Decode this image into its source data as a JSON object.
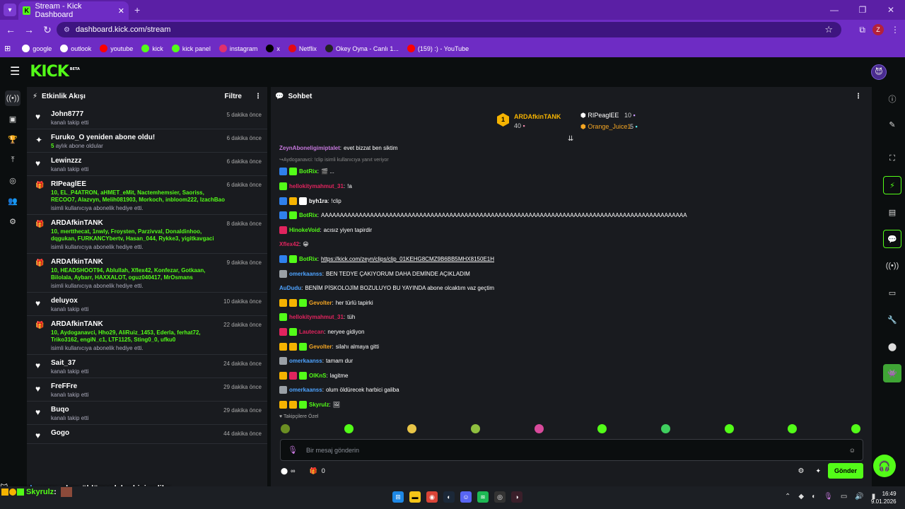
{
  "browser": {
    "tab_title": "Stream - Kick Dashboard",
    "tab_favicon": "K",
    "url": "dashboard.kick.com/stream",
    "profile_initial": "Z",
    "bookmarks": [
      {
        "label": "google",
        "icon": "globe-icon",
        "color": "#ffffff"
      },
      {
        "label": "outlook",
        "icon": "globe-icon",
        "color": "#ffffff"
      },
      {
        "label": "youtube",
        "icon": "youtube-icon",
        "color": "#ff0000"
      },
      {
        "label": "kick",
        "icon": "kick-icon",
        "color": "#53fc18"
      },
      {
        "label": "kick panel",
        "icon": "kick-icon",
        "color": "#53fc18"
      },
      {
        "label": "instagram",
        "icon": "instagram-icon",
        "color": "#e1306c"
      },
      {
        "label": "x",
        "icon": "x-icon",
        "color": "#000000"
      },
      {
        "label": "Netflix",
        "icon": "netflix-icon",
        "color": "#e50914"
      },
      {
        "label": "Okey Oyna - Canlı 1...",
        "icon": "okey-icon",
        "color": "#222222"
      },
      {
        "label": "(159) :) - YouTube",
        "icon": "youtube-icon",
        "color": "#ff0000"
      }
    ]
  },
  "app": {
    "logo": "KICK",
    "logo_badge": "BETA"
  },
  "activity": {
    "title": "Etkinlik Akışı",
    "filter_label": "Filtre",
    "events": [
      {
        "icon": "heart-icon",
        "name": "John8777",
        "time": "5 dakika önce",
        "sub": "kanalı takip etti",
        "extra": "",
        "extra_prefix": ""
      },
      {
        "icon": "sparkle-icon",
        "name": "Furuko_O yeniden abone oldu!",
        "time": "6 dakika önce",
        "sub": "aylık abone oldular",
        "extra": "",
        "extra_prefix": "5"
      },
      {
        "icon": "heart-icon",
        "name": "Lewinzzz",
        "time": "6 dakika önce",
        "sub": "kanalı takip etti",
        "extra": "",
        "extra_prefix": ""
      },
      {
        "icon": "gift-icon",
        "name": "RIPeaglEE",
        "time": "6 dakika önce",
        "sub": "isimli kullanıcıya abonelik hediye etti.",
        "extra": "10, EL_P4ATRON, aHMET_eMit, Nactemhemsier, Saoriss, RECOO7, Alazvyn, Melih081903, Morkoch, inbloom222, IzachBao",
        "extra_prefix": ""
      },
      {
        "icon": "gift-icon",
        "name": "ARDAfkinTANK",
        "time": "8 dakika önce",
        "sub": "isimli kullanıcıya abonelik hediye etti.",
        "extra": "10, mertthecat, 1nwly, Froysten, Parzivval, Donaldinhoo, dqgukan, FURKANCYbertv, Hasan_044, Rykke3, yigitkavgaci",
        "extra_prefix": ""
      },
      {
        "icon": "gift-icon",
        "name": "ARDAfkinTANK",
        "time": "9 dakika önce",
        "sub": "isimli kullanıcıya abonelik hediye etti.",
        "extra": "10, HEADSHOOT94, Ablullah, Xflex42, Konfezar, Gotkaan, Bilolala, Aybarr, HAXXALOT, oguz040417, MrOsmans",
        "extra_prefix": ""
      },
      {
        "icon": "heart-icon",
        "name": "deluyox",
        "time": "10 dakika önce",
        "sub": "kanalı takip etti",
        "extra": "",
        "extra_prefix": ""
      },
      {
        "icon": "gift-icon",
        "name": "ARDAfkinTANK",
        "time": "22 dakika önce",
        "sub": "isimli kullanıcıya abonelik hediye etti.",
        "extra": "10, Aydoganavci, Hho29, AliRuiz_1453, Ederla, ferhat72, Triko3162, engiN_c1, LTF1125, Sting0_0, ufku0",
        "extra_prefix": ""
      },
      {
        "icon": "heart-icon",
        "name": "Sait_37",
        "time": "24 dakika önce",
        "sub": "kanalı takip etti",
        "extra": "",
        "extra_prefix": ""
      },
      {
        "icon": "heart-icon",
        "name": "FreFFre",
        "time": "29 dakika önce",
        "sub": "kanalı takip etti",
        "extra": "",
        "extra_prefix": ""
      },
      {
        "icon": "heart-icon",
        "name": "Buqo",
        "time": "29 dakika önce",
        "sub": "kanalı takip etti",
        "extra": "",
        "extra_prefix": ""
      },
      {
        "icon": "heart-icon",
        "name": "Gogo",
        "time": "44 dakika önce",
        "sub": "",
        "extra": "",
        "extra_prefix": ""
      }
    ]
  },
  "chat": {
    "title": "Sohbet",
    "leaderboard": {
      "first": {
        "rank": "1",
        "name": "ARDAfkinTANK",
        "count": "40"
      },
      "second": {
        "name": "RIPeaglEE",
        "count": "10"
      },
      "third": {
        "name": "Orange_Juice1",
        "count": "5"
      }
    },
    "messages": [
      {
        "type": "msg",
        "badges": [],
        "user": "ZeynAboneligimiptalet",
        "color": "#c678dd",
        "text": "evet bizzat ben siktim"
      },
      {
        "type": "reply",
        "text": "Aydoganavci: !clip isimli kullanıcıya yanıt veriyor"
      },
      {
        "type": "msg",
        "badges": [
          "#2f80ed",
          "#53fc18"
        ],
        "user": "BotRix",
        "color": "#53fc18",
        "text": "🎬 ..."
      },
      {
        "type": "msg",
        "badges": [
          "#53fc18"
        ],
        "user": "hellokitymahmut_31",
        "color": "#e0245e",
        "text": "!a"
      },
      {
        "type": "msg",
        "badges": [
          "#2f80ed",
          "#f5b301",
          "#ffffff"
        ],
        "user": "byh1ra",
        "color": "#ffffff",
        "text": "!clip"
      },
      {
        "type": "msg",
        "badges": [
          "#2f80ed",
          "#53fc18"
        ],
        "user": "BotRix",
        "color": "#53fc18",
        "text": "AAAAAAAAAAAAAAAAAAAAAAAAAAAAAAAAAAAAAAAAAAAAAAAAAAAAAAAAAAAAAAAAAAAAAAAAAAAAAAAAAAAAAAAAAAAAAAAAA"
      },
      {
        "type": "msg",
        "badges": [
          "#e0245e"
        ],
        "user": "HinokeVoid",
        "color": "#53fc18",
        "text": "acısız yiyen tapirdir"
      },
      {
        "type": "msg",
        "badges": [],
        "user": "Xflex42",
        "color": "#e0245e",
        "text": "😀"
      },
      {
        "type": "msg",
        "badges": [
          "#2f80ed",
          "#53fc18"
        ],
        "user": "BotRix",
        "color": "#53fc18",
        "text": "https://kick.com/zeyn/clips/clip_01KEHG8CMZ9B6BB5MHX8150E1H"
      },
      {
        "type": "msg",
        "badges": [
          "#9aa0a6"
        ],
        "user": "omerkaanss",
        "color": "#4ea3ff",
        "text": "BEN TEDYE ÇAKIYORUM DAHA DEMİNDE AÇIKLADIM"
      },
      {
        "type": "msg",
        "badges": [],
        "user": "AuDudu",
        "color": "#4ea3ff",
        "text": "BENİM PİSKOLOJİM BOZULUYO BU YAYINDA abone olcaktım vaz geçtim"
      },
      {
        "type": "msg",
        "badges": [
          "#f5b301",
          "#f5b301",
          "#53fc18"
        ],
        "user": "Gevolter",
        "color": "#f5a623",
        "text": "her türlü tapirki"
      },
      {
        "type": "msg",
        "badges": [
          "#53fc18"
        ],
        "user": "hellokitymahmut_31",
        "color": "#e0245e",
        "text": "tüh"
      },
      {
        "type": "msg",
        "badges": [
          "#e0245e",
          "#53fc18"
        ],
        "user": "Lautecan",
        "color": "#e0245e",
        "text": "neryee gidiyon"
      },
      {
        "type": "msg",
        "badges": [
          "#f5b301",
          "#f5b301",
          "#53fc18"
        ],
        "user": "Gevolter",
        "color": "#f5a623",
        "text": "silahı almaya gitti"
      },
      {
        "type": "msg",
        "badges": [
          "#9aa0a6"
        ],
        "user": "omerkaanss",
        "color": "#4ea3ff",
        "text": "tamam dur"
      },
      {
        "type": "msg",
        "badges": [
          "#f5b301",
          "#e0245e",
          "#53fc18"
        ],
        "user": "OlKnS",
        "color": "#53fc18",
        "text": "lagitme"
      },
      {
        "type": "msg",
        "badges": [
          "#9aa0a6"
        ],
        "user": "omerkaanss",
        "color": "#4ea3ff",
        "text": "olum öldürecek harbici galiba"
      },
      {
        "type": "msg",
        "badges": [
          "#f5b301",
          "#f5b301",
          "#53fc18"
        ],
        "user": "Skyrulz",
        "color": "#53fc18",
        "text": "🖼"
      }
    ],
    "follower_only": "Takipçilere Özel",
    "input_placeholder": "Bir mesaj gönderin",
    "points": "∞",
    "gift_count": "0",
    "send_label": "Gönder"
  },
  "overlay": {
    "line1_user": "omerkaanss",
    "line1_text": ": olum öldürecek harbici galiba",
    "line2_user": "Skyrulz",
    "line2_text": " :"
  },
  "taskbar": {
    "time": "16:49",
    "date": "9.01.2026"
  }
}
